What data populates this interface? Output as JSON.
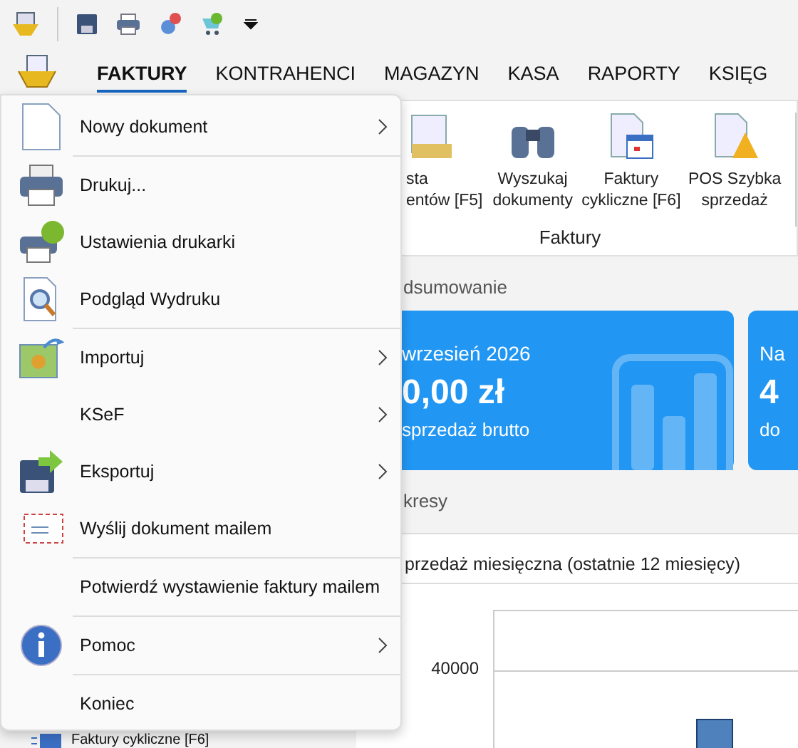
{
  "tabs": [
    {
      "label": "FAKTURY",
      "selected": true
    },
    {
      "label": "KONTRAHENCI",
      "selected": false
    },
    {
      "label": "MAGAZYN",
      "selected": false
    },
    {
      "label": "KASA",
      "selected": false
    },
    {
      "label": "RAPORTY",
      "selected": false
    },
    {
      "label": "KSIĘG",
      "selected": false
    }
  ],
  "ribbon": {
    "buttons": [
      {
        "lines": [
          "sta",
          "entów [F5]"
        ]
      },
      {
        "lines": [
          "Wyszukaj",
          "dokumenty"
        ]
      },
      {
        "lines": [
          "Faktury",
          "cykliczne [F6]"
        ]
      },
      {
        "lines": [
          "POS Szybka",
          "sprzedaż"
        ]
      }
    ],
    "group_label": "Faktury"
  },
  "summary": {
    "heading": "dsumowanie",
    "cards": [
      {
        "period": "wrzesień 2026",
        "amount": "0,00 zł",
        "caption": "sprzedaż brutto"
      },
      {
        "period": "Na",
        "amount": "4",
        "caption": "do"
      }
    ]
  },
  "charts": {
    "heading": "kresy",
    "panel_title": "przedaż miesięczna (ostatnie 12 miesięcy)",
    "y_tick": "40000"
  },
  "side_item": "Faktury cykliczne [F6]",
  "menu": [
    {
      "label": "Nowy dokument",
      "submenu": true,
      "divider_after": true
    },
    {
      "label": "Drukuj...",
      "submenu": false,
      "divider_after": false
    },
    {
      "label": "Ustawienia drukarki",
      "submenu": false,
      "divider_after": false
    },
    {
      "label": "Podgląd Wydruku",
      "submenu": false,
      "divider_after": true
    },
    {
      "label": "Importuj",
      "submenu": true,
      "divider_after": false
    },
    {
      "label": "KSeF",
      "submenu": true,
      "divider_after": false
    },
    {
      "label": "Eksportuj",
      "submenu": true,
      "divider_after": false
    },
    {
      "label": "Wyślij dokument mailem",
      "submenu": false,
      "divider_after": true
    },
    {
      "label": "Potwierdź wystawienie faktury mailem",
      "submenu": false,
      "divider_after": true
    },
    {
      "label": "Pomoc",
      "submenu": true,
      "divider_after": true
    },
    {
      "label": "Koniec",
      "submenu": false,
      "divider_after": false
    }
  ]
}
